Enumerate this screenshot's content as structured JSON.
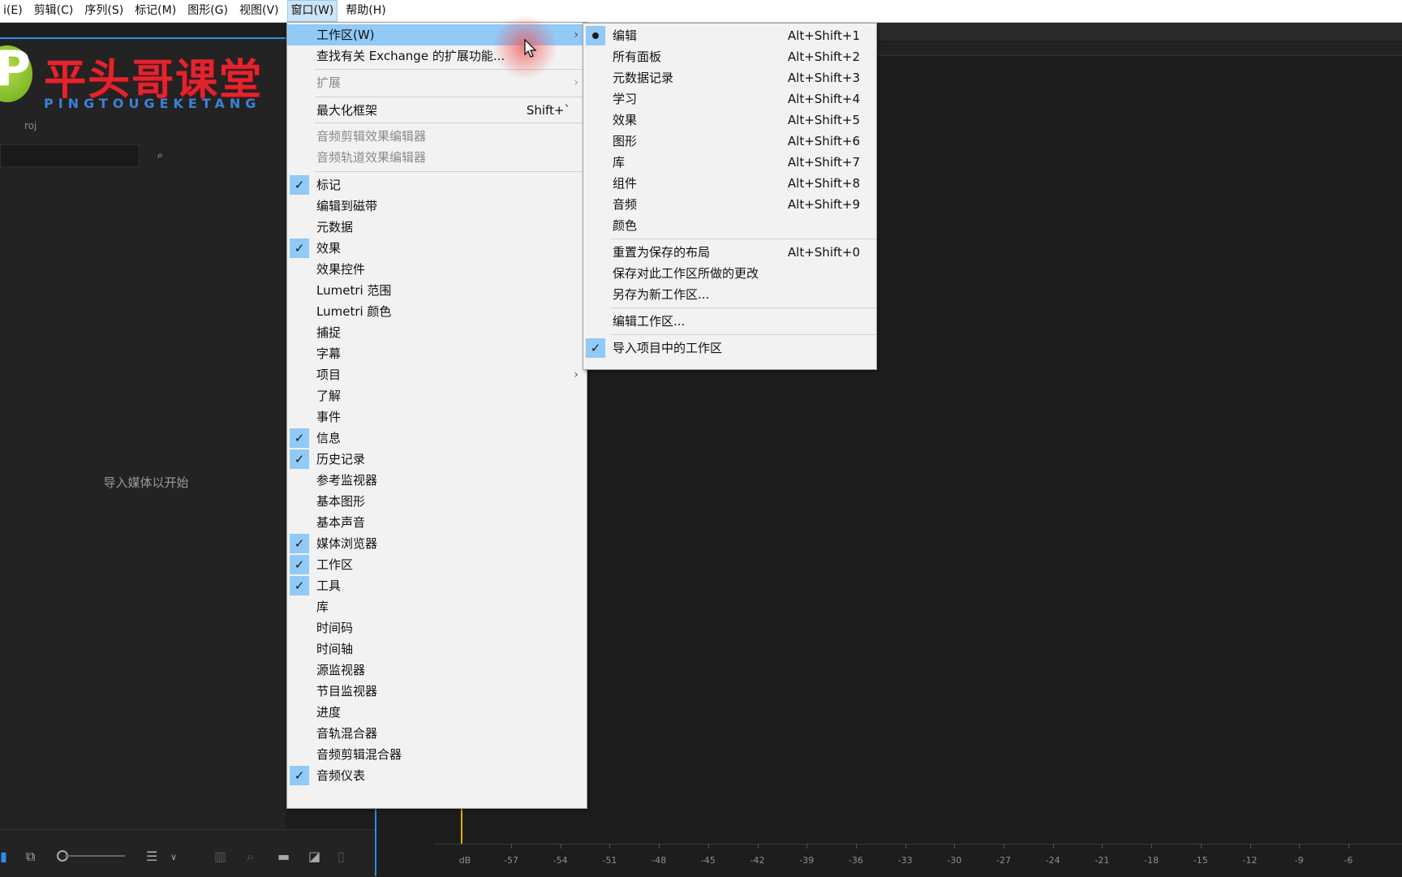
{
  "menubar": {
    "items": [
      "i(E)",
      "剪辑(C)",
      "序列(S)",
      "标记(M)",
      "图形(G)",
      "视图(V)",
      "窗口(W)",
      "帮助(H)"
    ],
    "active_index": 6
  },
  "logo": {
    "title": "平头哥课堂",
    "subtitle": "PINGTOUGEKETANG"
  },
  "project_panel": {
    "proj_label": "roj",
    "empty_message": "导入媒体以开始"
  },
  "window_menu": {
    "items": [
      {
        "label": "工作区(W)",
        "arrow": "›",
        "highlight": true
      },
      {
        "label": "查找有关 Exchange 的扩展功能..."
      },
      {
        "label": "扩展",
        "arrow": "›",
        "disabled": true
      },
      {
        "label": "最大化框架",
        "shortcut": "Shift+`"
      },
      {
        "label": "音频剪辑效果编辑器",
        "disabled": true
      },
      {
        "label": "音频轨道效果编辑器",
        "disabled": true
      },
      {
        "label": "标记",
        "checked": true
      },
      {
        "label": "编辑到磁带"
      },
      {
        "label": "元数据"
      },
      {
        "label": "效果",
        "checked": true
      },
      {
        "label": "效果控件"
      },
      {
        "label": "Lumetri 范围"
      },
      {
        "label": "Lumetri 颜色"
      },
      {
        "label": "捕捉"
      },
      {
        "label": "字幕"
      },
      {
        "label": "项目",
        "arrow": "›"
      },
      {
        "label": "了解"
      },
      {
        "label": "事件"
      },
      {
        "label": "信息",
        "checked": true
      },
      {
        "label": "历史记录",
        "checked": true
      },
      {
        "label": "参考监视器"
      },
      {
        "label": "基本图形"
      },
      {
        "label": "基本声音"
      },
      {
        "label": "媒体浏览器",
        "checked": true
      },
      {
        "label": "工作区",
        "checked": true
      },
      {
        "label": "工具",
        "checked": true
      },
      {
        "label": "库"
      },
      {
        "label": "时间码"
      },
      {
        "label": "时间轴"
      },
      {
        "label": "源监视器"
      },
      {
        "label": "节目监视器"
      },
      {
        "label": "进度"
      },
      {
        "label": "音轨混合器"
      },
      {
        "label": "音频剪辑混合器"
      },
      {
        "label": "音频仪表",
        "checked": true
      }
    ]
  },
  "workspace_submenu": {
    "items": [
      {
        "label": "编辑",
        "shortcut": "Alt+Shift+1",
        "bullet": true
      },
      {
        "label": "所有面板",
        "shortcut": "Alt+Shift+2"
      },
      {
        "label": "元数据记录",
        "shortcut": "Alt+Shift+3"
      },
      {
        "label": "学习",
        "shortcut": "Alt+Shift+4"
      },
      {
        "label": "效果",
        "shortcut": "Alt+Shift+5"
      },
      {
        "label": "图形",
        "shortcut": "Alt+Shift+6"
      },
      {
        "label": "库",
        "shortcut": "Alt+Shift+7"
      },
      {
        "label": "组件",
        "shortcut": "Alt+Shift+8"
      },
      {
        "label": "音频",
        "shortcut": "Alt+Shift+9"
      },
      {
        "label": "颜色"
      },
      {
        "label": "重置为保存的布局",
        "shortcut": "Alt+Shift+0"
      },
      {
        "label": "保存对此工作区所做的更改"
      },
      {
        "label": "另存为新工作区..."
      },
      {
        "label": "编辑工作区..."
      },
      {
        "label": "导入项目中的工作区",
        "checked": true
      }
    ]
  },
  "audio_meter": {
    "unit": "dB",
    "ticks": [
      "-57",
      "-54",
      "-51",
      "-48",
      "-45",
      "-42",
      "-39",
      "-36",
      "-33",
      "-30",
      "-27",
      "-24",
      "-21",
      "-18",
      "-15",
      "-12",
      "-9",
      "-6"
    ]
  },
  "colors": {
    "menu_highlight": "#91c9f7",
    "app_background": "#1d1d1d",
    "accent_blue": "#2d8ceb",
    "logo_red": "#e2242f"
  }
}
